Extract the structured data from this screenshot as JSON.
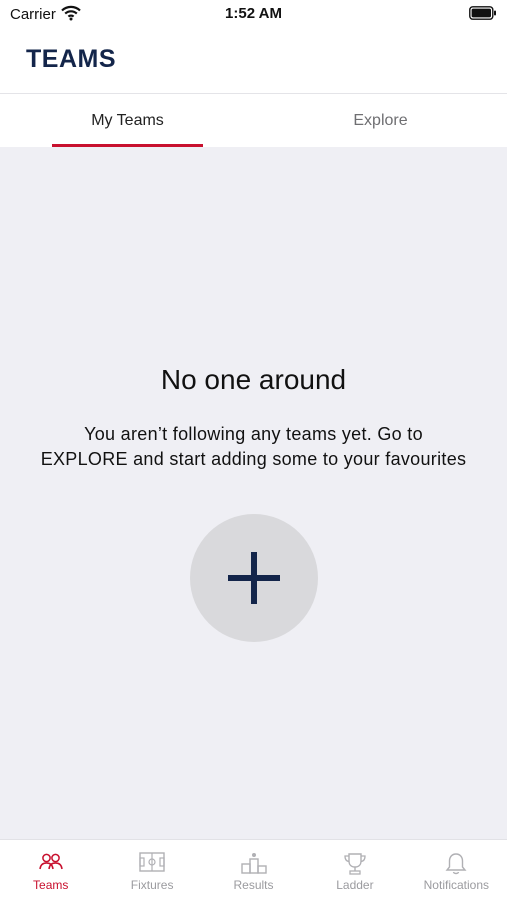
{
  "status_bar": {
    "carrier": "Carrier",
    "time": "1:52 AM"
  },
  "header": {
    "title": "TEAMS"
  },
  "tabs": [
    {
      "label": "My Teams",
      "active": true
    },
    {
      "label": "Explore",
      "active": false
    }
  ],
  "empty_state": {
    "title": "No one around",
    "message": "You aren’t following any teams yet. Go to EXPLORE and start adding some to your favourites"
  },
  "bottom_nav": [
    {
      "label": "Teams",
      "icon": "teams-icon",
      "active": true
    },
    {
      "label": "Fixtures",
      "icon": "fixtures-icon",
      "active": false
    },
    {
      "label": "Results",
      "icon": "results-icon",
      "active": false
    },
    {
      "label": "Ladder",
      "icon": "ladder-icon",
      "active": false
    },
    {
      "label": "Notifications",
      "icon": "notifications-icon",
      "active": false
    }
  ],
  "colors": {
    "accent": "#c8102e",
    "title": "#13254a",
    "background": "#efeff4",
    "inactive": "#9b9b9f"
  }
}
